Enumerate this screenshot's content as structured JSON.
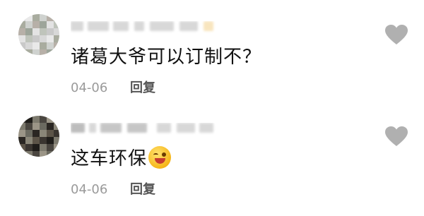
{
  "comments": [
    {
      "text": "诸葛大爷可以订制不？",
      "date": "04-06",
      "reply_label": "回复",
      "avatar_palette": [
        "#d8d8d8",
        "#c9c9c9",
        "#bfc4bb",
        "#e3e3e3",
        "#9da59a",
        "#b7b0a8",
        "#cfd2cf",
        "#a9ac9f",
        "#e9e9e9"
      ],
      "icons": {
        "like": "heart-icon"
      }
    },
    {
      "text": "这车环保",
      "emoji": "laughing-wink-emoji",
      "date": "04-06",
      "reply_label": "回复",
      "avatar_palette": [
        "#3a3530",
        "#5c5448",
        "#8a8678",
        "#2a2622",
        "#6b6a60",
        "#9b9587",
        "#4a4640",
        "#7d7a6e",
        "#1f1d1a"
      ],
      "icons": {
        "like": "heart-icon"
      }
    }
  ],
  "colors": {
    "text": "#111111",
    "meta": "#9a9a9a",
    "reply": "#555555",
    "heart": "#b0b0b0"
  }
}
